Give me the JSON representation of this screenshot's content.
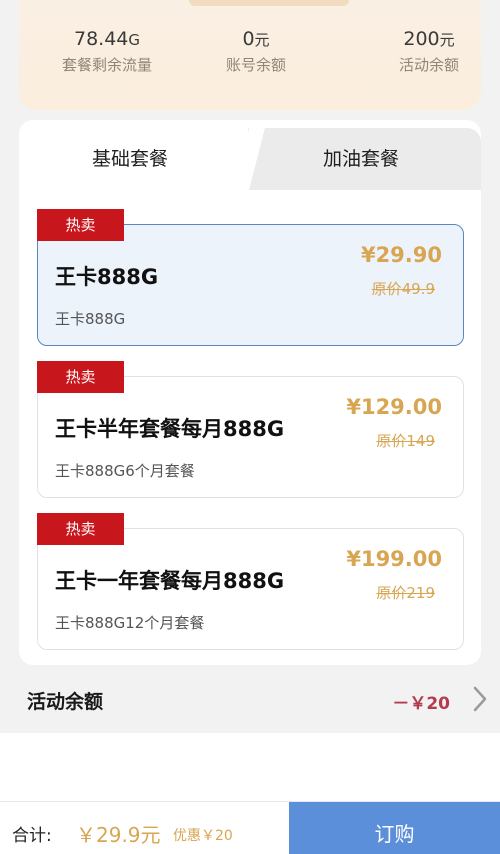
{
  "stats": [
    {
      "value": "78.44",
      "unit": "G",
      "label": "套餐剩余流量"
    },
    {
      "value": "0",
      "unit": "元",
      "label": "账号余额"
    },
    {
      "value": "200",
      "unit": "元",
      "label": "活动余额"
    }
  ],
  "tabs": [
    {
      "label": "基础套餐",
      "active": true
    },
    {
      "label": "加油套餐",
      "active": false
    }
  ],
  "plans": [
    {
      "badge": "热卖",
      "name": "王卡888G",
      "desc": "王卡888G",
      "price": "¥29.90",
      "original": "原价49.9",
      "selected": true
    },
    {
      "badge": "热卖",
      "name": "王卡半年套餐每月888G",
      "desc": "王卡888G6个月套餐",
      "price": "¥129.00",
      "original": "原价149",
      "selected": false
    },
    {
      "badge": "热卖",
      "name": "王卡一年套餐每月888G",
      "desc": "王卡888G12个月套餐",
      "price": "¥199.00",
      "original": "原价219",
      "selected": false
    }
  ],
  "activity": {
    "label": "活动余额",
    "amount": "－￥20"
  },
  "footer": {
    "total_label": "合计:",
    "total_value": "￥29.9元",
    "discount": "优惠￥20",
    "order_label": "订购"
  },
  "colors": {
    "accent_gold": "#d8a652",
    "badge_red": "#c8161d",
    "button_blue": "#5b8fd9"
  }
}
